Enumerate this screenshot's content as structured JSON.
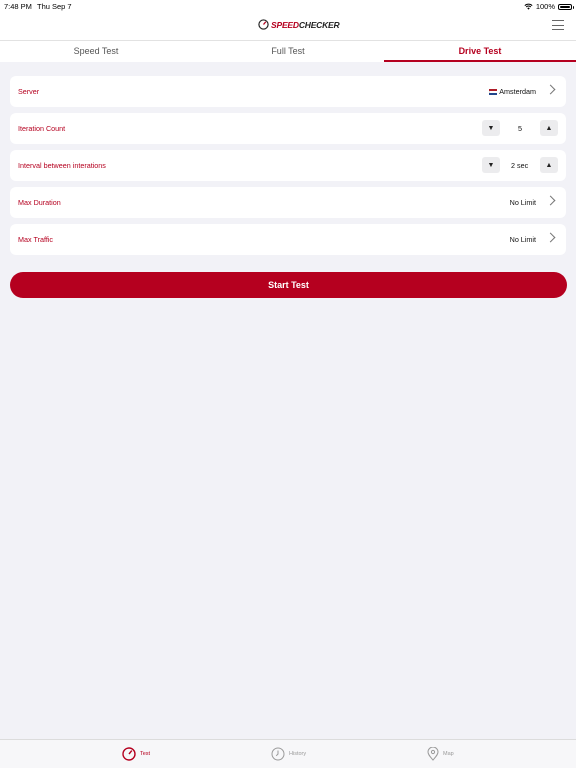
{
  "status_bar": {
    "time": "7:48 PM",
    "date": "Thu Sep 7",
    "battery": "100%"
  },
  "header": {
    "logo_part1": "SPEED",
    "logo_part2": "CHECKER"
  },
  "tabs": [
    {
      "label": "Speed Test",
      "active": false
    },
    {
      "label": "Full Test",
      "active": false
    },
    {
      "label": "Drive Test",
      "active": true
    }
  ],
  "settings": {
    "server": {
      "label": "Server",
      "value": "Amsterdam"
    },
    "iteration_count": {
      "label": "Iteration Count",
      "value": "5",
      "dec": "▼",
      "inc": "▲"
    },
    "interval": {
      "label": "Interval between interations",
      "value": "2 sec",
      "dec": "▼",
      "inc": "▲"
    },
    "max_duration": {
      "label": "Max Duration",
      "value": "No Limit"
    },
    "max_traffic": {
      "label": "Max Traffic",
      "value": "No Limit"
    }
  },
  "start_button": {
    "label": "Start Test"
  },
  "bottom_tabs": [
    {
      "label": "Test",
      "active": true,
      "icon": "speedometer-icon"
    },
    {
      "label": "History",
      "active": false,
      "icon": "clock-icon"
    },
    {
      "label": "Map",
      "active": false,
      "icon": "map-pin-icon"
    }
  ],
  "colors": {
    "accent": "#b5001f",
    "background": "#f2f2f7"
  }
}
